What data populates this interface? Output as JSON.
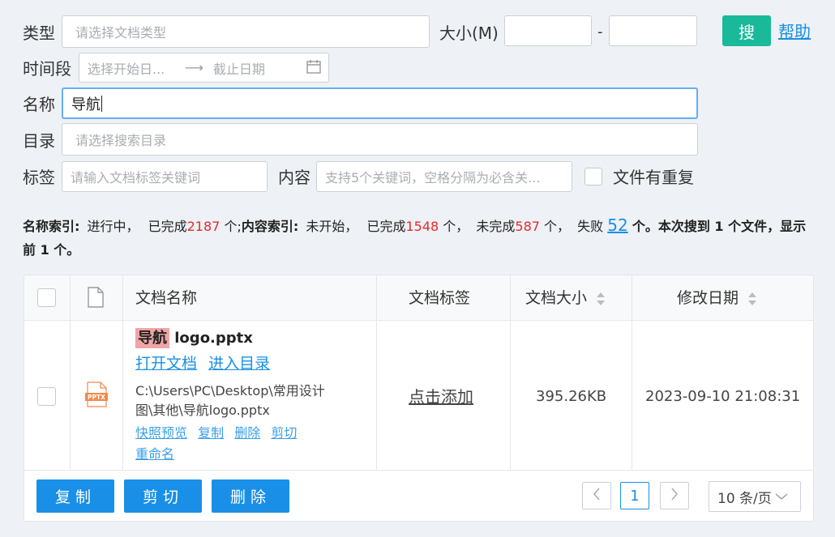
{
  "filters": {
    "type_label": "类型",
    "type_placeholder": "请选择文档类型",
    "size_label": "大小(M)",
    "size_dash": "-",
    "search_button": "搜",
    "help_link": "帮助",
    "time_label": "时间段",
    "start_date_placeholder": "选择开始日...",
    "end_date_placeholder": "截止日期",
    "name_label": "名称",
    "name_value": "导航",
    "dir_label": "目录",
    "dir_placeholder": "请选择搜索目录",
    "tag_label": "标签",
    "tag_placeholder": "请输入文档标签关键词",
    "content_label": "内容",
    "content_placeholder": "支持5个关键词，空格分隔为必含关...",
    "duplicate_label": "文件有重复"
  },
  "stats": {
    "name_index_label": "名称索引:",
    "name_index_status": "进行中，",
    "done_prefix": "已完成",
    "name_done_count": "2187",
    "unit_semicolon": "个;",
    "content_index_label": "内容索引:",
    "content_index_status": "未开始，",
    "content_done_count": "1548",
    "unit_comma": "个，",
    "undone_prefix": "未完成",
    "undone_count": "587",
    "failed_prefix": "失败",
    "failed_count": "52",
    "summary": "个。本次搜到 1 个文件，显示前 1 个。"
  },
  "table": {
    "col_name": "文档名称",
    "col_tag": "文档标签",
    "col_size": "文档大小",
    "col_date": "修改日期",
    "row": {
      "file_icon_text": "PPTX",
      "name_highlight": "导航",
      "name_rest": " logo.pptx",
      "open_doc": "打开文档",
      "enter_dir": "进入目录",
      "path_line1": "C:\\Users\\PC\\Desktop\\常用设计",
      "path_line2": "图\\其他\\导航logo.pptx",
      "snapshot": "快照预览",
      "copy": "复制",
      "delete": "删除",
      "cut": "剪切",
      "rename": "重命名",
      "tag_action": "点击添加",
      "size": "395.26KB",
      "date": "2023-09-10 21:08:31"
    }
  },
  "footer": {
    "copy_button": "复制",
    "cut_button": "剪切",
    "delete_button": "删除",
    "current_page": "1",
    "page_size": "10 条/页"
  },
  "colors": {
    "search_button": "#19b99a",
    "action_button": "#1a8fe8",
    "highlight": "#f1a5a5",
    "count_red": "#e52a2a"
  }
}
